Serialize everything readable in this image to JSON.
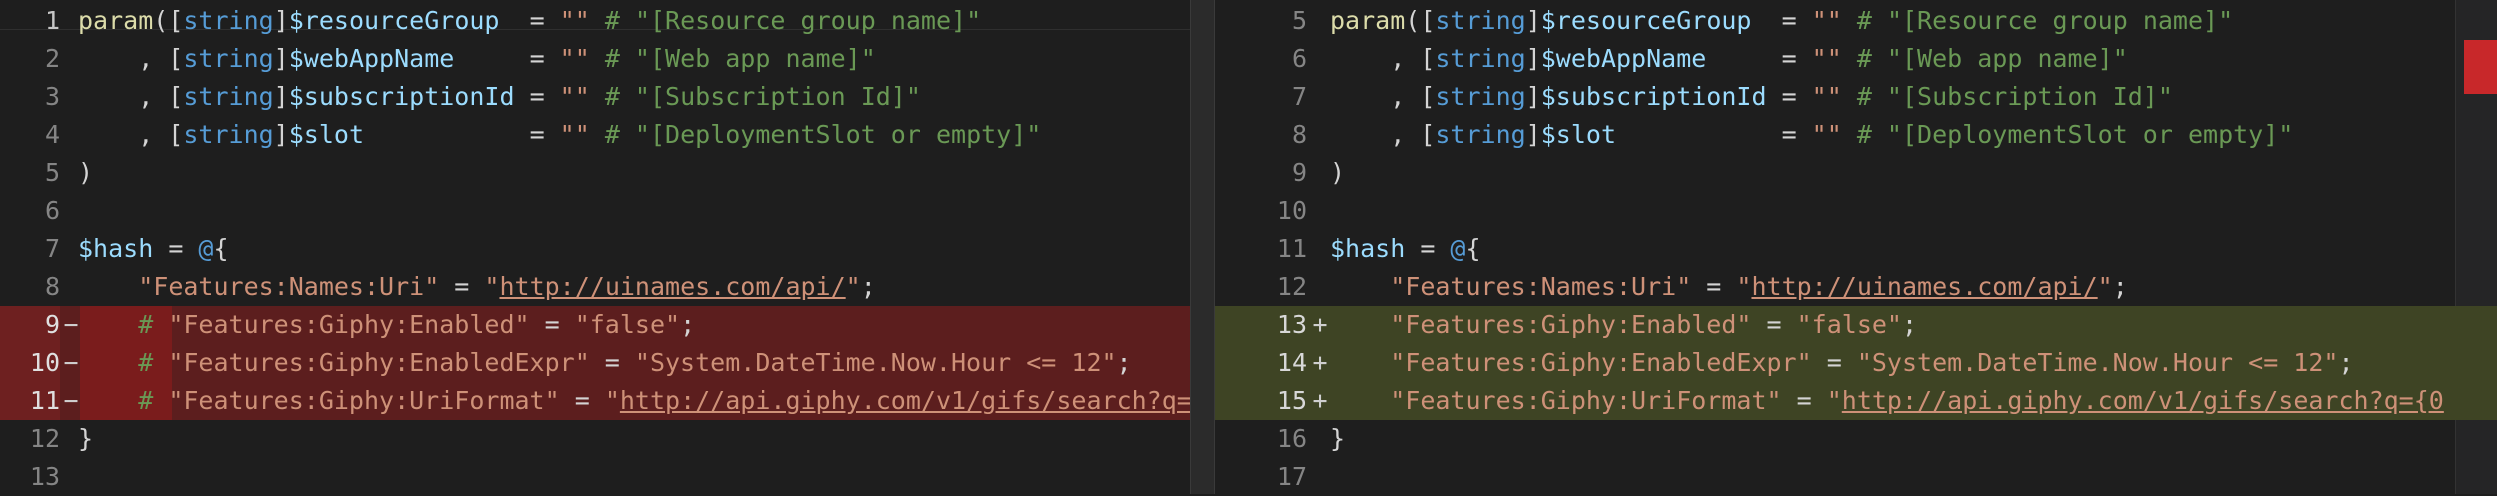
{
  "colors": {
    "deleted": "#5c1e1e",
    "added": "#3e4424"
  },
  "left": {
    "lines": [
      {
        "num": "1",
        "marker": "",
        "type": "",
        "tokens": [
          {
            "t": "param",
            "c": "fn"
          },
          {
            "t": "([",
            "c": "pun"
          },
          {
            "t": "string",
            "c": "ty"
          },
          {
            "t": "]",
            "c": "pun"
          },
          {
            "t": "$resourceGroup",
            "c": "var"
          },
          {
            "t": "  = ",
            "c": "pun"
          },
          {
            "t": "\"\"",
            "c": "str"
          },
          {
            "t": " # \"[Resource group name]\"",
            "c": "com"
          }
        ]
      },
      {
        "num": "2",
        "marker": "",
        "type": "",
        "tokens": [
          {
            "t": "    , [",
            "c": "pun"
          },
          {
            "t": "string",
            "c": "ty"
          },
          {
            "t": "]",
            "c": "pun"
          },
          {
            "t": "$webAppName",
            "c": "var"
          },
          {
            "t": "     = ",
            "c": "pun"
          },
          {
            "t": "\"\"",
            "c": "str"
          },
          {
            "t": " # \"[Web app name]\"",
            "c": "com"
          }
        ]
      },
      {
        "num": "3",
        "marker": "",
        "type": "",
        "tokens": [
          {
            "t": "    , [",
            "c": "pun"
          },
          {
            "t": "string",
            "c": "ty"
          },
          {
            "t": "]",
            "c": "pun"
          },
          {
            "t": "$subscriptionId",
            "c": "var"
          },
          {
            "t": " = ",
            "c": "pun"
          },
          {
            "t": "\"\"",
            "c": "str"
          },
          {
            "t": " # \"[Subscription Id]\"",
            "c": "com"
          }
        ]
      },
      {
        "num": "4",
        "marker": "",
        "type": "",
        "tokens": [
          {
            "t": "    , [",
            "c": "pun"
          },
          {
            "t": "string",
            "c": "ty"
          },
          {
            "t": "]",
            "c": "pun"
          },
          {
            "t": "$slot",
            "c": "var"
          },
          {
            "t": "           = ",
            "c": "pun"
          },
          {
            "t": "\"\"",
            "c": "str"
          },
          {
            "t": " # \"[DeploymentSlot or empty]\"",
            "c": "com"
          }
        ]
      },
      {
        "num": "5",
        "marker": "",
        "type": "",
        "tokens": [
          {
            "t": ")",
            "c": "pun"
          }
        ]
      },
      {
        "num": "6",
        "marker": "",
        "type": "",
        "tokens": []
      },
      {
        "num": "7",
        "marker": "",
        "type": "",
        "tokens": [
          {
            "t": "$hash",
            "c": "var"
          },
          {
            "t": " = ",
            "c": "pun"
          },
          {
            "t": "@",
            "c": "at"
          },
          {
            "t": "{",
            "c": "pun"
          }
        ]
      },
      {
        "num": "8",
        "marker": "",
        "type": "",
        "tokens": [
          {
            "t": "    ",
            "c": "pun"
          },
          {
            "t": "\"Features:Names:Uri\"",
            "c": "str"
          },
          {
            "t": " = ",
            "c": "pun"
          },
          {
            "t": "\"",
            "c": "str"
          },
          {
            "t": "http://uinames.com/api/",
            "c": "url"
          },
          {
            "t": "\"",
            "c": "str"
          },
          {
            "t": ";",
            "c": "pun"
          }
        ]
      },
      {
        "num": "9",
        "marker": "−",
        "type": "del",
        "tokens": [
          {
            "t": "    # ",
            "c": "com"
          },
          {
            "t": "\"Features:Giphy:Enabled\"",
            "c": "str"
          },
          {
            "t": " = ",
            "c": "pun"
          },
          {
            "t": "\"false\"",
            "c": "str"
          },
          {
            "t": ";",
            "c": "pun"
          }
        ]
      },
      {
        "num": "10",
        "marker": "−",
        "type": "del",
        "tokens": [
          {
            "t": "    # ",
            "c": "com"
          },
          {
            "t": "\"Features:Giphy:EnabledExpr\"",
            "c": "str"
          },
          {
            "t": " = ",
            "c": "pun"
          },
          {
            "t": "\"System.DateTime.Now.Hour <= 12\"",
            "c": "str"
          },
          {
            "t": ";",
            "c": "pun"
          }
        ]
      },
      {
        "num": "11",
        "marker": "−",
        "type": "del",
        "tokens": [
          {
            "t": "    # ",
            "c": "com"
          },
          {
            "t": "\"Features:Giphy:UriFormat\"",
            "c": "str"
          },
          {
            "t": " = ",
            "c": "pun"
          },
          {
            "t": "\"",
            "c": "str"
          },
          {
            "t": "http://api.giphy.com/v1/gifs/search?q=",
            "c": "url"
          }
        ]
      },
      {
        "num": "12",
        "marker": "",
        "type": "",
        "tokens": [
          {
            "t": "}",
            "c": "pun"
          }
        ]
      },
      {
        "num": "13",
        "marker": "",
        "type": "",
        "tokens": []
      }
    ]
  },
  "right": {
    "lines": [
      {
        "num": "5",
        "marker": "",
        "type": "",
        "tokens": [
          {
            "t": "param",
            "c": "fn"
          },
          {
            "t": "([",
            "c": "pun"
          },
          {
            "t": "string",
            "c": "ty"
          },
          {
            "t": "]",
            "c": "pun"
          },
          {
            "t": "$resourceGroup",
            "c": "var"
          },
          {
            "t": "  = ",
            "c": "pun"
          },
          {
            "t": "\"\"",
            "c": "str"
          },
          {
            "t": " # \"[Resource group name]\"",
            "c": "com"
          }
        ]
      },
      {
        "num": "6",
        "marker": "",
        "type": "",
        "tokens": [
          {
            "t": "    , [",
            "c": "pun"
          },
          {
            "t": "string",
            "c": "ty"
          },
          {
            "t": "]",
            "c": "pun"
          },
          {
            "t": "$webAppName",
            "c": "var"
          },
          {
            "t": "     = ",
            "c": "pun"
          },
          {
            "t": "\"\"",
            "c": "str"
          },
          {
            "t": " # \"[Web app name]\"",
            "c": "com"
          }
        ]
      },
      {
        "num": "7",
        "marker": "",
        "type": "",
        "tokens": [
          {
            "t": "    , [",
            "c": "pun"
          },
          {
            "t": "string",
            "c": "ty"
          },
          {
            "t": "]",
            "c": "pun"
          },
          {
            "t": "$subscriptionId",
            "c": "var"
          },
          {
            "t": " = ",
            "c": "pun"
          },
          {
            "t": "\"\"",
            "c": "str"
          },
          {
            "t": " # \"[Subscription Id]\"",
            "c": "com"
          }
        ]
      },
      {
        "num": "8",
        "marker": "",
        "type": "",
        "tokens": [
          {
            "t": "    , [",
            "c": "pun"
          },
          {
            "t": "string",
            "c": "ty"
          },
          {
            "t": "]",
            "c": "pun"
          },
          {
            "t": "$slot",
            "c": "var"
          },
          {
            "t": "           = ",
            "c": "pun"
          },
          {
            "t": "\"\"",
            "c": "str"
          },
          {
            "t": " # \"[DeploymentSlot or empty]\"",
            "c": "com"
          }
        ]
      },
      {
        "num": "9",
        "marker": "",
        "type": "",
        "tokens": [
          {
            "t": ")",
            "c": "pun"
          }
        ]
      },
      {
        "num": "10",
        "marker": "",
        "type": "",
        "tokens": []
      },
      {
        "num": "11",
        "marker": "",
        "type": "",
        "tokens": [
          {
            "t": "$hash",
            "c": "var"
          },
          {
            "t": " = ",
            "c": "pun"
          },
          {
            "t": "@",
            "c": "at"
          },
          {
            "t": "{",
            "c": "pun"
          }
        ]
      },
      {
        "num": "12",
        "marker": "",
        "type": "",
        "tokens": [
          {
            "t": "    ",
            "c": "pun"
          },
          {
            "t": "\"Features:Names:Uri\"",
            "c": "str"
          },
          {
            "t": " = ",
            "c": "pun"
          },
          {
            "t": "\"",
            "c": "str"
          },
          {
            "t": "http://uinames.com/api/",
            "c": "url"
          },
          {
            "t": "\"",
            "c": "str"
          },
          {
            "t": ";",
            "c": "pun"
          }
        ]
      },
      {
        "num": "13",
        "marker": "+",
        "type": "add",
        "tokens": [
          {
            "t": "    ",
            "c": "pun"
          },
          {
            "t": "\"Features:Giphy:Enabled\"",
            "c": "str"
          },
          {
            "t": " = ",
            "c": "pun"
          },
          {
            "t": "\"false\"",
            "c": "str"
          },
          {
            "t": ";",
            "c": "pun"
          }
        ]
      },
      {
        "num": "14",
        "marker": "+",
        "type": "add",
        "tokens": [
          {
            "t": "    ",
            "c": "pun"
          },
          {
            "t": "\"Features:Giphy:EnabledExpr\"",
            "c": "str"
          },
          {
            "t": " = ",
            "c": "pun"
          },
          {
            "t": "\"System.DateTime.Now.Hour <= 12\"",
            "c": "str"
          },
          {
            "t": ";",
            "c": "pun"
          }
        ]
      },
      {
        "num": "15",
        "marker": "+",
        "type": "add",
        "tokens": [
          {
            "t": "    ",
            "c": "pun"
          },
          {
            "t": "\"Features:Giphy:UriFormat\"",
            "c": "str"
          },
          {
            "t": " = ",
            "c": "pun"
          },
          {
            "t": "\"",
            "c": "str"
          },
          {
            "t": "http://api.giphy.com/v1/gifs/search?q={0",
            "c": "url"
          }
        ]
      },
      {
        "num": "16",
        "marker": "",
        "type": "",
        "tokens": [
          {
            "t": "}",
            "c": "pun"
          }
        ]
      },
      {
        "num": "17",
        "marker": "",
        "type": "",
        "tokens": []
      }
    ]
  }
}
